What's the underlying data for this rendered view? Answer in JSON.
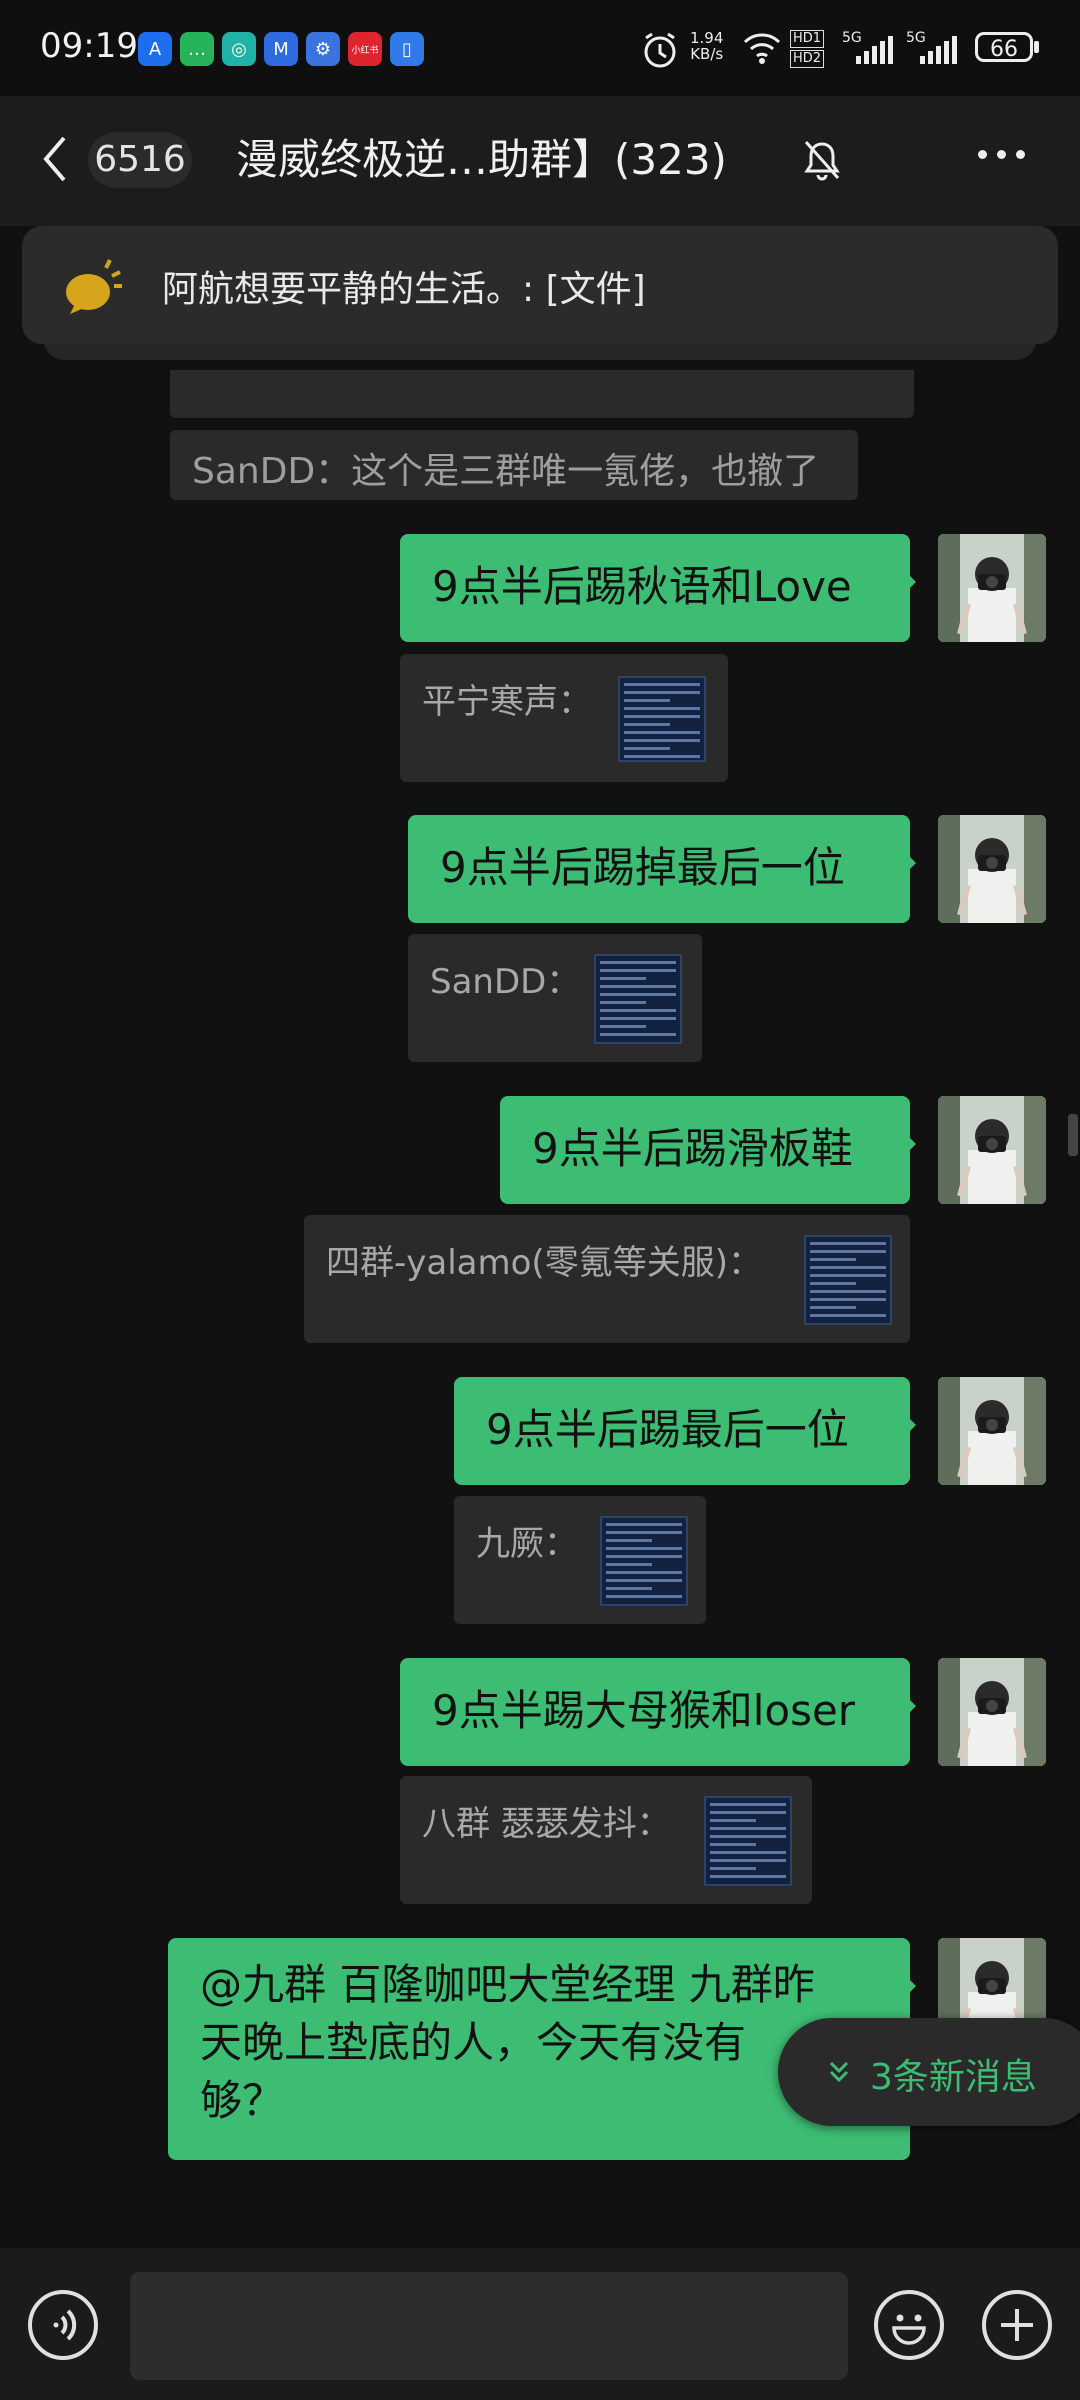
{
  "status_bar": {
    "time": "09:19",
    "net_speed_value": "1.94",
    "net_speed_unit": "KB/s",
    "hd1": "HD1",
    "hd2": "HD2",
    "signal1_label": "5G",
    "signal2_label": "5G",
    "battery": "66",
    "app_icons": [
      {
        "name": "app-a-icon",
        "color": "#1e6ff0",
        "glyph": "A"
      },
      {
        "name": "app-chat-icon",
        "color": "#27b35a",
        "glyph": "…"
      },
      {
        "name": "app-teal-icon",
        "color": "#1fb3a7",
        "glyph": "◎"
      },
      {
        "name": "app-blue-icon",
        "color": "#2f6be0",
        "glyph": "M"
      },
      {
        "name": "app-settings-icon",
        "color": "#3a74e0",
        "glyph": "⚙"
      },
      {
        "name": "app-shop-icon",
        "color": "#e0242f",
        "glyph": "小红书"
      },
      {
        "name": "app-phone-icon",
        "color": "#2f7ae8",
        "glyph": "▯"
      }
    ]
  },
  "header": {
    "unread_count": "6516",
    "title": "漫威终极逆…助群】(323)"
  },
  "notice": {
    "text": "阿航想要平静的生活。: [文件]"
  },
  "messages": {
    "sys1": "SanDD：这个是三群唯一氪佬，也撤了",
    "m1": "9点半后踢秋语和Love",
    "q1": "平宁寒声：",
    "m2": "9点半后踢掉最后一位",
    "q2": "SanDD：",
    "m3": "9点半后踢滑板鞋",
    "q3": "四群-yalamo(零氪等关服)：",
    "m4": "9点半后踢最后一位",
    "q4": "九厥：",
    "m5": "9点半踢大母猴和loser",
    "q5": "八群 瑟瑟发抖：",
    "m6_line1": "@九群 百隆咖吧大堂经理  九群昨",
    "m6_line2": "天晚上垫底的人，今天有没有",
    "m6_line3": "够？"
  },
  "new_messages_pill": "3条新消息",
  "colors": {
    "accent_green": "#3dbd74",
    "background": "#111111",
    "bubble_grey": "#2a2a2a"
  }
}
